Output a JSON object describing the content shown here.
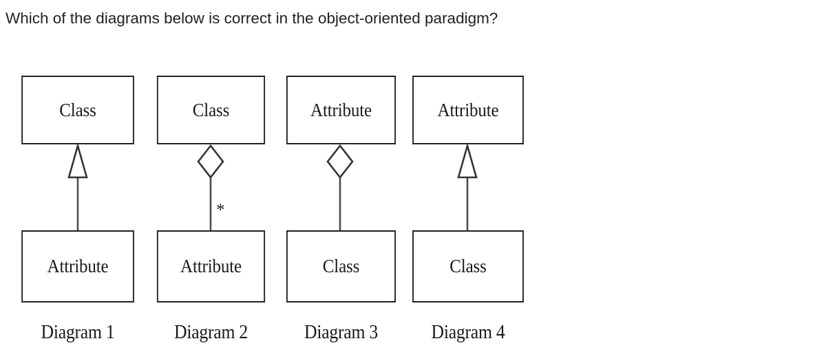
{
  "question": {
    "text": "Which of the diagrams below is correct in the object-oriented paradigm?"
  },
  "figure": {
    "diagrams": [
      {
        "caption": "Diagram 1",
        "top_box": "Class",
        "bottom_box": "Attribute",
        "relationship": "generalization",
        "end_shape": "hollow-triangle",
        "multiplicity": ""
      },
      {
        "caption": "Diagram 2",
        "top_box": "Class",
        "bottom_box": "Attribute",
        "relationship": "aggregation",
        "end_shape": "hollow-diamond",
        "multiplicity": "*"
      },
      {
        "caption": "Diagram 3",
        "top_box": "Attribute",
        "bottom_box": "Class",
        "relationship": "aggregation",
        "end_shape": "hollow-diamond",
        "multiplicity": ""
      },
      {
        "caption": "Diagram 4",
        "top_box": "Attribute",
        "bottom_box": "Class",
        "relationship": "generalization",
        "end_shape": "hollow-triangle",
        "multiplicity": ""
      }
    ]
  },
  "colors": {
    "text": "#231f20",
    "box_border": "#231f20",
    "connector": "#4d4d4d",
    "background": "#ffffff"
  }
}
